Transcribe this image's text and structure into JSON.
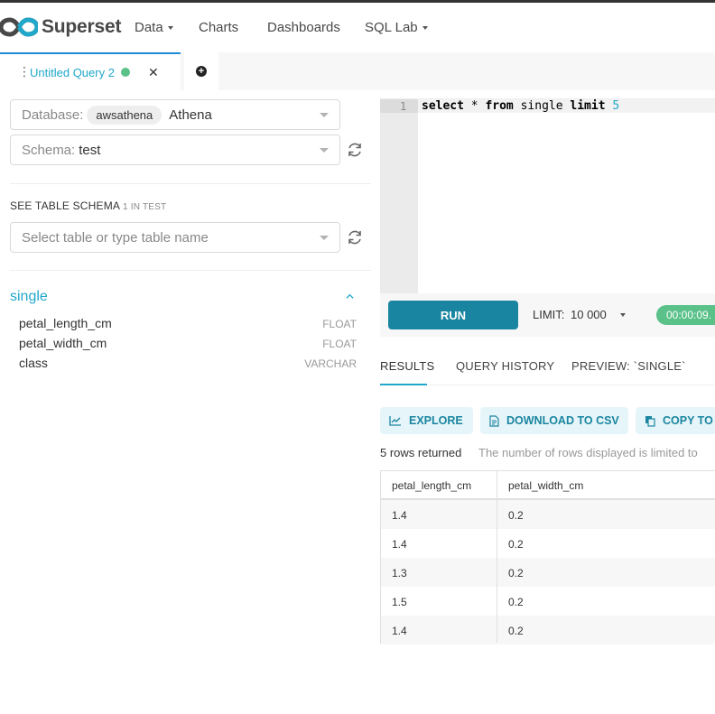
{
  "brand": {
    "name": "Superset"
  },
  "nav": {
    "items": [
      {
        "label": "Data",
        "dropdown": true
      },
      {
        "label": "Charts",
        "dropdown": false
      },
      {
        "label": "Dashboards",
        "dropdown": false
      },
      {
        "label": "SQL Lab",
        "dropdown": true
      }
    ]
  },
  "tabs": {
    "active": {
      "title": "Untitled Query 2",
      "status_color": "#5ac189"
    }
  },
  "left": {
    "database": {
      "label": "Database:",
      "chip": "awsathena",
      "value": "Athena"
    },
    "schema": {
      "label": "Schema:",
      "value": "test"
    },
    "see_table_schema": {
      "label": "SEE TABLE SCHEMA",
      "count": "1 IN TEST"
    },
    "table_select": {
      "placeholder": "Select table or type table name"
    },
    "table": {
      "name": "single",
      "columns": [
        {
          "name": "petal_length_cm",
          "type": "FLOAT"
        },
        {
          "name": "petal_width_cm",
          "type": "FLOAT"
        },
        {
          "name": "class",
          "type": "VARCHAR"
        }
      ]
    }
  },
  "editor": {
    "line_number": "1",
    "tokens": [
      {
        "text": "select",
        "kw": true
      },
      {
        "text": " * ",
        "kw": false
      },
      {
        "text": "from",
        "kw": true
      },
      {
        "text": " single ",
        "kw": false
      },
      {
        "text": "limit",
        "kw": true
      },
      {
        "text": " 5",
        "kw": false
      }
    ]
  },
  "runbar": {
    "run_label": "RUN",
    "limit_label": "LIMIT:",
    "limit_value": "10 000",
    "timer": "00:00:09.",
    "timer_color": "#5ac189",
    "run_color": "#1a85a0"
  },
  "results": {
    "tabs": [
      "RESULTS",
      "QUERY HISTORY",
      "PREVIEW: `SINGLE`"
    ],
    "actions": [
      "EXPLORE",
      "DOWNLOAD TO CSV",
      "COPY TO C"
    ],
    "rows_returned": "5 rows returned",
    "rows_note": "The number of rows displayed is limited to",
    "columns": [
      "petal_length_cm",
      "petal_width_cm"
    ],
    "rows": [
      [
        "1.4",
        "0.2"
      ],
      [
        "1.4",
        "0.2"
      ],
      [
        "1.3",
        "0.2"
      ],
      [
        "1.5",
        "0.2"
      ],
      [
        "1.4",
        "0.2"
      ]
    ]
  }
}
